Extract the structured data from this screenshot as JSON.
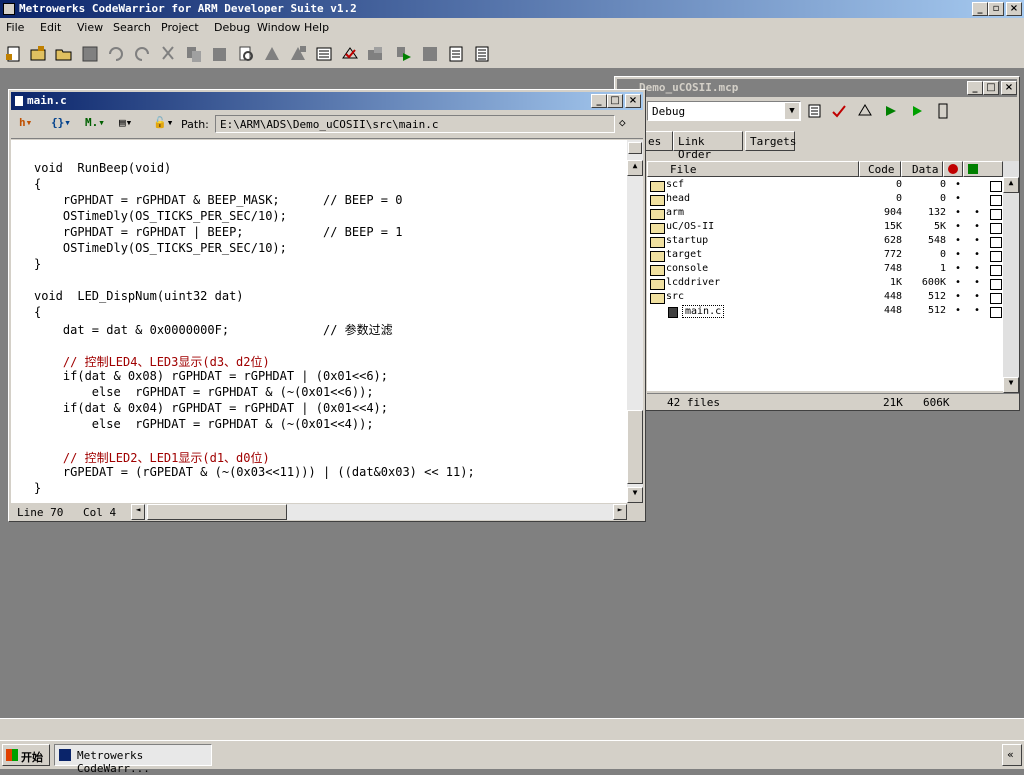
{
  "window": {
    "title": "Metrowerks CodeWarrior for ARM Developer Suite v1.2"
  },
  "menu": [
    "File",
    "Edit",
    "View",
    "Search",
    "Project",
    "Debug",
    "Window",
    "Help"
  ],
  "toolbar_icons": [
    "new-text-icon",
    "new-project-icon",
    "open-icon",
    "save-icon",
    "undo-icon",
    "redo-icon",
    "cut-icon",
    "copy-icon",
    "paste-icon",
    "find-icon",
    "find-next-icon",
    "replace-icon",
    "file-list-icon",
    "compile-icon",
    "make-icon",
    "debug-run-icon",
    "stop-icon",
    "new-file-icon",
    "project-window-icon"
  ],
  "editor": {
    "title": "main.c",
    "path_label": "Path:",
    "path": "E:\\ARM\\ADS\\Demo_uCOSII\\src\\main.c",
    "status_line": "Line 70",
    "status_col": "Col 4",
    "lines": [
      "void  RunBeep(void)",
      "{",
      "    rGPHDAT = rGPHDAT & BEEP_MASK;      // BEEP = 0",
      "    OSTimeDly(OS_TICKS_PER_SEC/10);",
      "    rGPHDAT = rGPHDAT | BEEP;           // BEEP = 1",
      "    OSTimeDly(OS_TICKS_PER_SEC/10);",
      "}",
      "",
      "void  LED_DispNum(uint32 dat)",
      "{",
      "    dat = dat & 0x0000000F;             // 参数过滤",
      "",
      "    // 控制LED4、LED3显示(d3、d2位)",
      "    if(dat & 0x08) rGPHDAT = rGPHDAT | (0x01<<6);",
      "        else  rGPHDAT = rGPHDAT & (~(0x01<<6));",
      "    if(dat & 0x04) rGPHDAT = rGPHDAT | (0x01<<4);",
      "        else  rGPHDAT = rGPHDAT & (~(0x01<<4));",
      "",
      "    // 控制LED2、LED1显示(d1、d0位)",
      "    rGPEDAT = (rGPEDAT & (~(0x03<<11))) | ((dat&0x03) << 11);",
      "}"
    ]
  },
  "project": {
    "title": "Demo_uCOSII.mcp",
    "target": "Debug",
    "tabs": [
      "es",
      "Link Order",
      "Targets"
    ],
    "columns": {
      "file": "File",
      "code": "Code",
      "data": "Data"
    },
    "files": [
      {
        "name": "scf",
        "code": "0",
        "data": "0"
      },
      {
        "name": "head",
        "code": "0",
        "data": "0"
      },
      {
        "name": "arm",
        "code": "904",
        "data": "132"
      },
      {
        "name": "uC/OS-II",
        "code": "15K",
        "data": "5K"
      },
      {
        "name": "startup",
        "code": "628",
        "data": "548"
      },
      {
        "name": "target",
        "code": "772",
        "data": "0"
      },
      {
        "name": "console",
        "code": "748",
        "data": "1"
      },
      {
        "name": "lcddriver",
        "code": "1K",
        "data": "600K"
      },
      {
        "name": "src",
        "code": "448",
        "data": "512"
      },
      {
        "name": "main.c",
        "code": "448",
        "data": "512"
      }
    ],
    "footer": {
      "count": "42 files",
      "code": "21K",
      "data": "606K"
    }
  },
  "taskbar": {
    "start": "开始",
    "task": "Metrowerks CodeWarr...",
    "tray": "«"
  },
  "colors": {
    "titlebar": "#0a246a",
    "code_identifier": "#3c5a8c",
    "comment": "#a00000",
    "face": "#d4d0c8"
  }
}
